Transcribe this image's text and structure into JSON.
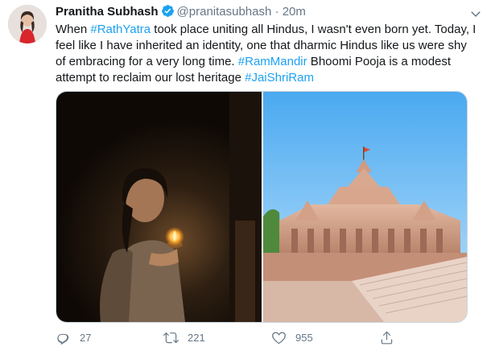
{
  "tweet": {
    "display_name": "Pranitha Subhash",
    "handle": "@pranitasubhash",
    "separator": "·",
    "time": "20m",
    "text_parts": {
      "p1": "When ",
      "h1": "#RathYatra",
      "p2": " took place uniting all Hindus, I wasn't even born yet. Today, I feel like I have inherited an identity, one that dharmic Hindus like us were shy of embracing for a very long time. ",
      "h2": "#RamMandir",
      "p3": " Bhoomi Pooja is a modest attempt to reclaim our lost heritage ",
      "h3": "#JaiShriRam"
    },
    "replies": "27",
    "retweets": "221",
    "likes": "955"
  },
  "icons": {
    "verified": "verified-badge-icon",
    "menu": "chevron-down-icon",
    "reply": "reply-icon",
    "retweet": "retweet-icon",
    "like": "heart-icon",
    "share": "share-icon"
  },
  "colors": {
    "link": "#1da1f2",
    "muted": "#657786",
    "text": "#14171a",
    "verified": "#1da1f2"
  }
}
